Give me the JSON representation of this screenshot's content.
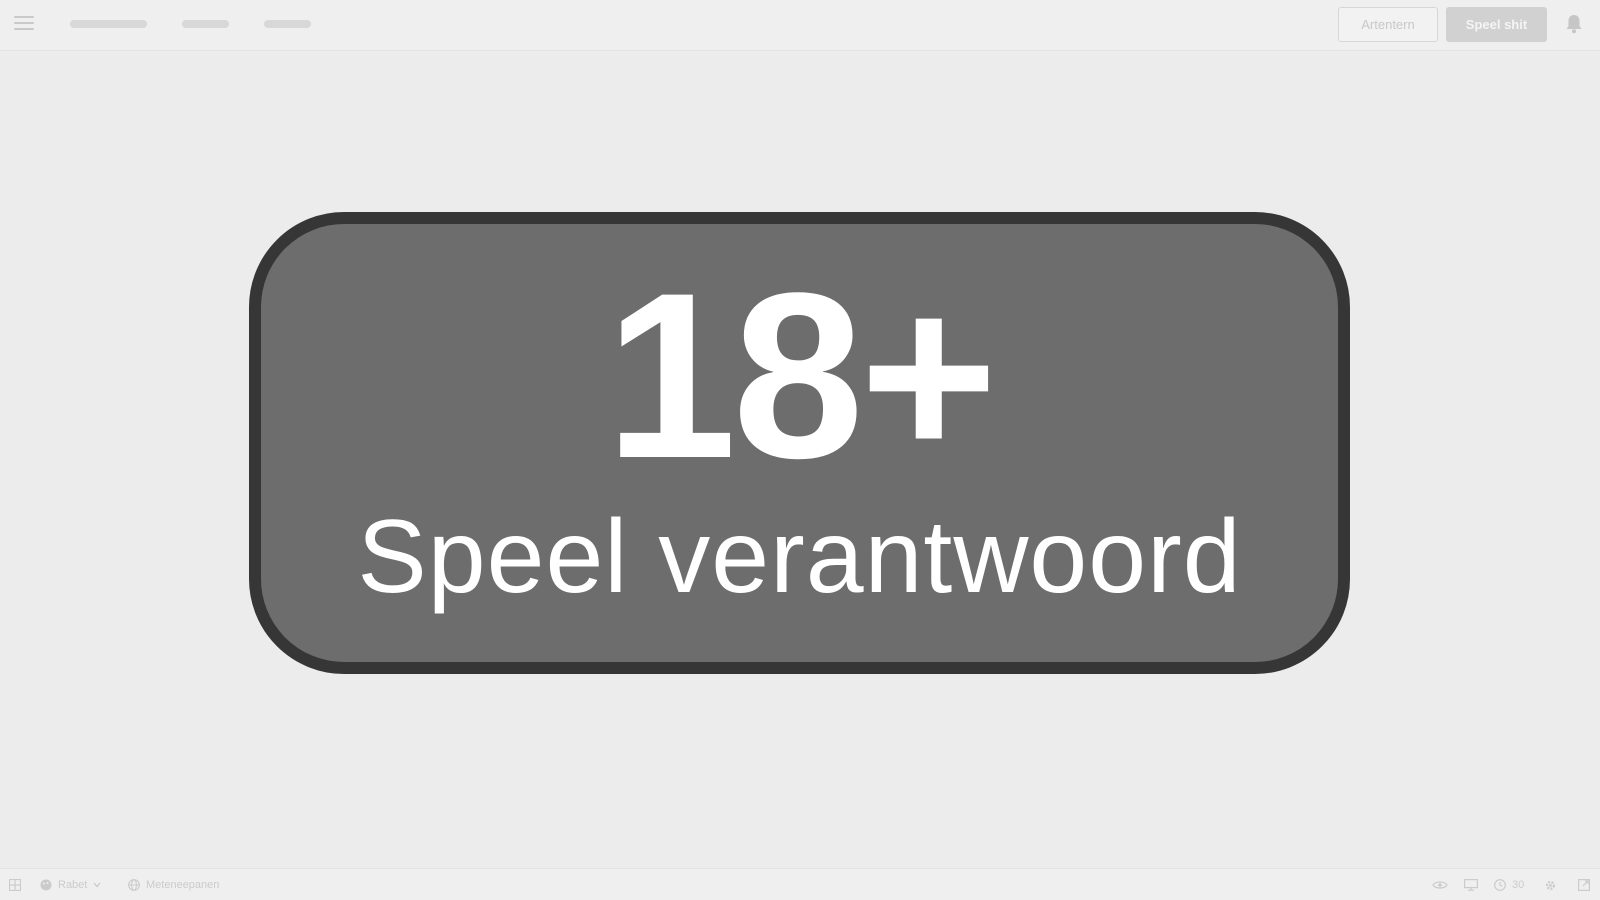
{
  "topbar": {
    "menu_icon": "hamburger-icon",
    "secondary_button_label": "Artentern",
    "primary_button_label": "Speel shit",
    "notification_icon": "bell-icon"
  },
  "badge": {
    "age_label": "18+",
    "message": "Speel verantwoord",
    "fill_color": "#6d6d6d",
    "border_color": "#363636",
    "text_color": "#ffffff"
  },
  "statusbar": {
    "left": {
      "layout_icon": "grid-icon",
      "profile_icon": "palette-icon",
      "profile_label": "Rabet",
      "language_icon": "globe-icon",
      "language_label": "Meteneepanen"
    },
    "right": {
      "view_icon": "eye-icon",
      "screen_icon": "monitor-icon",
      "timer_icon": "clock-icon",
      "timer_value": "30",
      "settings_icon": "gear-icon",
      "fullscreen_icon": "expand-icon"
    }
  }
}
